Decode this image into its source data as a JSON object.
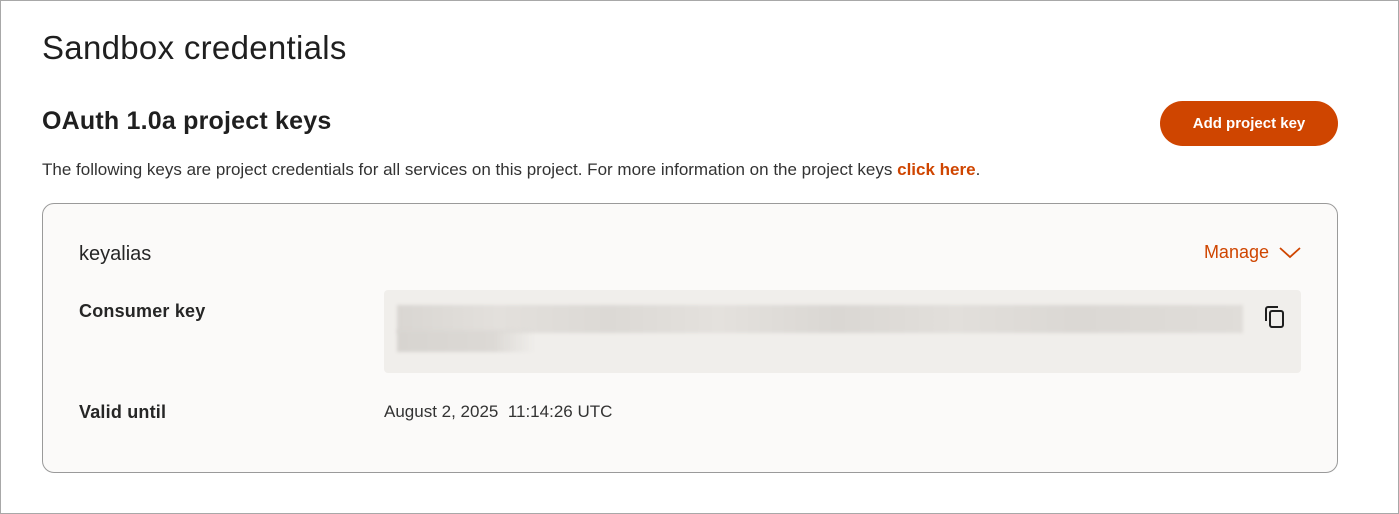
{
  "page": {
    "title": "Sandbox credentials"
  },
  "section": {
    "title": "OAuth 1.0a project keys",
    "add_button_label": "Add project key",
    "description": "The following keys are project credentials for all services on this project. For more information on the project keys ",
    "description_link": "click here",
    "description_end": "."
  },
  "key_card": {
    "alias": "keyalias",
    "manage_label": "Manage",
    "manage_icon": "chevron-down-icon",
    "consumer_key_label": "Consumer key",
    "consumer_key_value_state": "redacted",
    "copy_icon": "copy-icon",
    "valid_until_label": "Valid until",
    "valid_until_value": "August 2, 2025  11:14:26 UTC"
  },
  "colors": {
    "accent": "#cf4500",
    "card_background": "#fbfaf9",
    "key_field_background": "#f0eeeb",
    "text": "#1f1f1f"
  }
}
